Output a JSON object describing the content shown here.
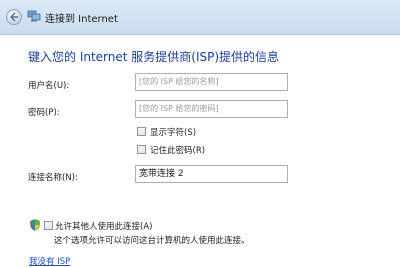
{
  "window": {
    "title": "连接到 Internet"
  },
  "heading": "键入您的 Internet 服务提供商(ISP)提供的信息",
  "form": {
    "username": {
      "label": "用户名(U):",
      "placeholder": "[您的 ISP 给您的名称]"
    },
    "password": {
      "label": "密码(P):",
      "placeholder": "[您的 ISP 给您的密码]"
    },
    "show_chars": {
      "label": "显示字符(S)",
      "checked": false
    },
    "remember_password": {
      "label": "记住此密码(R)",
      "checked": false
    },
    "connection_name": {
      "label": "连接名称(N):",
      "value": "宽带连接 2"
    },
    "allow_others": {
      "label": "允许其他人使用此连接(A)",
      "checked": false,
      "note": "这个选项允许可以访问这台计算机的人使用此连接。"
    }
  },
  "links": {
    "no_isp": "我没有 ISP"
  },
  "icons": [
    "back-arrow-icon",
    "network-icon",
    "shield-icon"
  ]
}
